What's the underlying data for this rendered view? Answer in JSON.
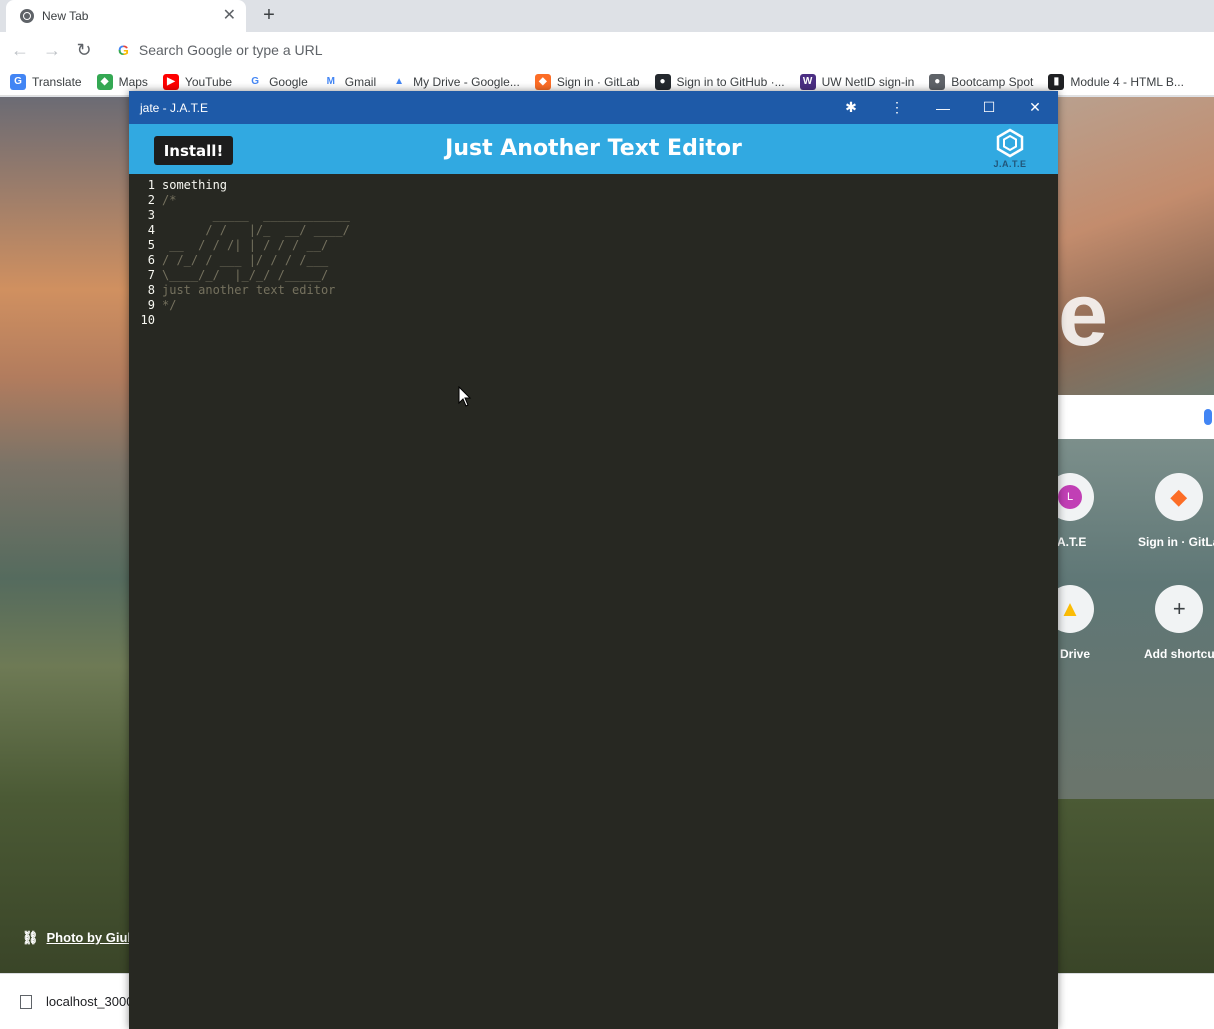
{
  "browser": {
    "tab": {
      "title": "New Tab",
      "close": "✕",
      "favicon": "chrome-icon"
    },
    "new_tab": "+",
    "nav": {
      "back": "←",
      "forward": "→",
      "reload": "↻"
    },
    "omnibox": {
      "logo": "G",
      "placeholder": "Search Google or type a URL"
    },
    "bookmarks": [
      {
        "label": "Translate",
        "icon": "translate-icon",
        "color": "#4285f4",
        "glyph": "G"
      },
      {
        "label": "Maps",
        "icon": "maps-icon",
        "color": "#34a853",
        "glyph": "◆"
      },
      {
        "label": "YouTube",
        "icon": "youtube-icon",
        "color": "#ff0000",
        "glyph": "▶"
      },
      {
        "label": "Google",
        "icon": "google-icon",
        "color": "#ffffff",
        "glyph": "G"
      },
      {
        "label": "Gmail",
        "icon": "gmail-icon",
        "color": "#ffffff",
        "glyph": "M"
      },
      {
        "label": "My Drive - Google...",
        "icon": "drive-icon",
        "color": "#ffffff",
        "glyph": "▲"
      },
      {
        "label": "Sign in · GitLab",
        "icon": "gitlab-icon",
        "color": "#fc6d26",
        "glyph": "◆"
      },
      {
        "label": "Sign in to GitHub ·...",
        "icon": "github-icon",
        "color": "#24292e",
        "glyph": "●"
      },
      {
        "label": "UW NetID sign-in",
        "icon": "uw-icon",
        "color": "#4b2e83",
        "glyph": "W"
      },
      {
        "label": "Bootcamp Spot",
        "icon": "globe-icon",
        "color": "#5f6368",
        "glyph": "●"
      },
      {
        "label": "Module 4 - HTML B...",
        "icon": "book-icon",
        "color": "#202124",
        "glyph": "▮"
      }
    ]
  },
  "ntp": {
    "shortcuts": [
      {
        "label": ".A.T.E",
        "glyph": "L",
        "color": "#c13fb5"
      },
      {
        "label": "Sign in · GitLa",
        "glyph": "◆",
        "color": "#fc6d26"
      },
      {
        "label": "y Drive",
        "glyph": "▲",
        "color": "#fbbc05"
      },
      {
        "label": "Add shortcu",
        "glyph": "+",
        "color": "#3c4043"
      }
    ],
    "photo_credit": "Photo by Giul",
    "big_letter": "e"
  },
  "downloads": {
    "file": "localhost_3000"
  },
  "pwa": {
    "window_title": "jate - J.A.T.E",
    "controls": {
      "extensions": "✱",
      "menu": "⋮",
      "minimize": "—",
      "maximize": "☐",
      "close": "✕"
    },
    "install_label": "Install!",
    "app_title": "Just Another Text Editor",
    "logo_text": "J.A.T.E"
  },
  "editor": {
    "lines": [
      {
        "n": "1",
        "text": "something",
        "style": "plain"
      },
      {
        "n": "2",
        "text": "/*",
        "style": "comment"
      },
      {
        "n": "3",
        "text": "       _____  ____________",
        "style": "comment"
      },
      {
        "n": "4",
        "text": "      / /   |/_  __/ ____/",
        "style": "comment"
      },
      {
        "n": "5",
        "text": " __  / / /| | / / / __/",
        "style": "comment"
      },
      {
        "n": "6",
        "text": "/ /_/ / ___ |/ / / /___",
        "style": "comment"
      },
      {
        "n": "7",
        "text": "\\____/_/  |_/_/ /_____/",
        "style": "comment"
      },
      {
        "n": "8",
        "text": "just another text editor",
        "style": "comment"
      },
      {
        "n": "9",
        "text": "*/",
        "style": "comment"
      },
      {
        "n": "10",
        "text": "",
        "style": "comment"
      }
    ]
  }
}
